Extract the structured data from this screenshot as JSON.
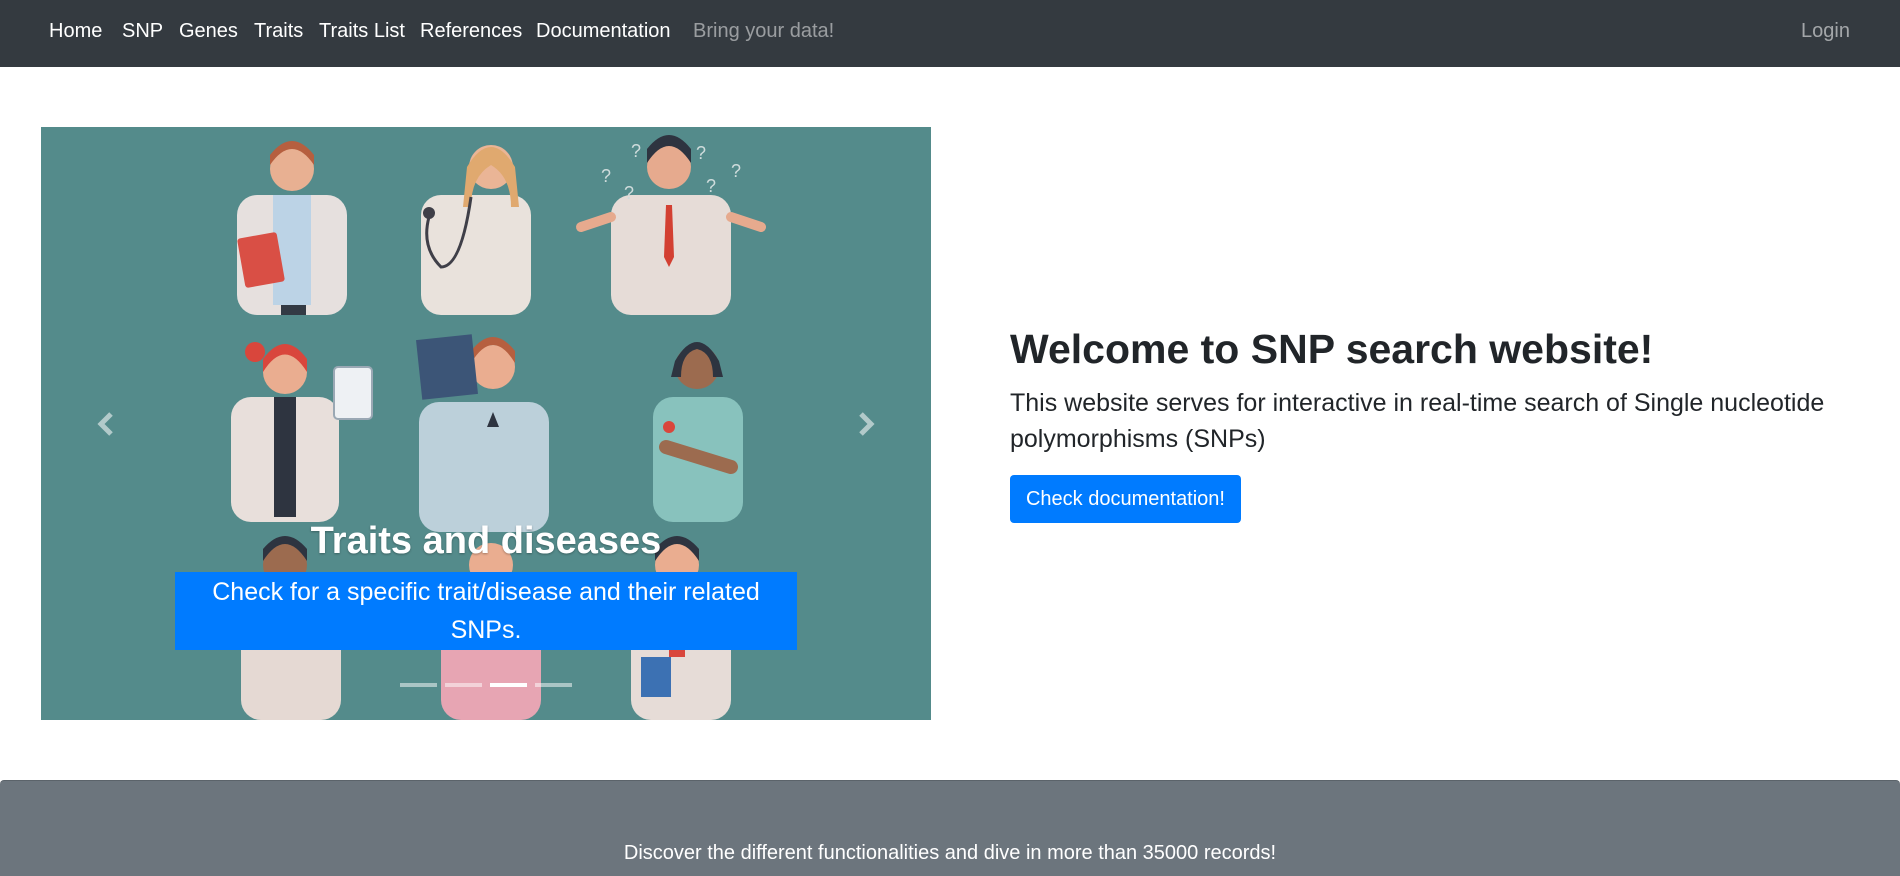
{
  "navbar": {
    "items": [
      {
        "label": "Home"
      },
      {
        "label": "SNP"
      },
      {
        "label": "Genes"
      },
      {
        "label": "Traits"
      },
      {
        "label": "Traits List"
      },
      {
        "label": "References"
      },
      {
        "label": "Documentation"
      },
      {
        "label": "Bring your data!",
        "disabled": true
      }
    ],
    "login_label": "Login"
  },
  "carousel": {
    "slide_title": "Traits and diseases",
    "slide_caption": "Check for a specific trait/disease and their related SNPs.",
    "slide_count": 4,
    "active_index": 2,
    "prev_icon": "chevron-left-icon",
    "next_icon": "chevron-right-icon",
    "background_color": "#548b8b"
  },
  "welcome": {
    "title": "Welcome to SNP search website!",
    "text": "This website serves for interactive in real-time search of Single nucleotide polymorphisms (SNPs)",
    "button_label": "Check documentation!"
  },
  "banner": {
    "text": "Discover the different functionalities and dive in more than 35000 records!"
  },
  "colors": {
    "navbar_bg": "#343a40",
    "primary": "#007bff",
    "banner_bg": "#6c757d"
  }
}
